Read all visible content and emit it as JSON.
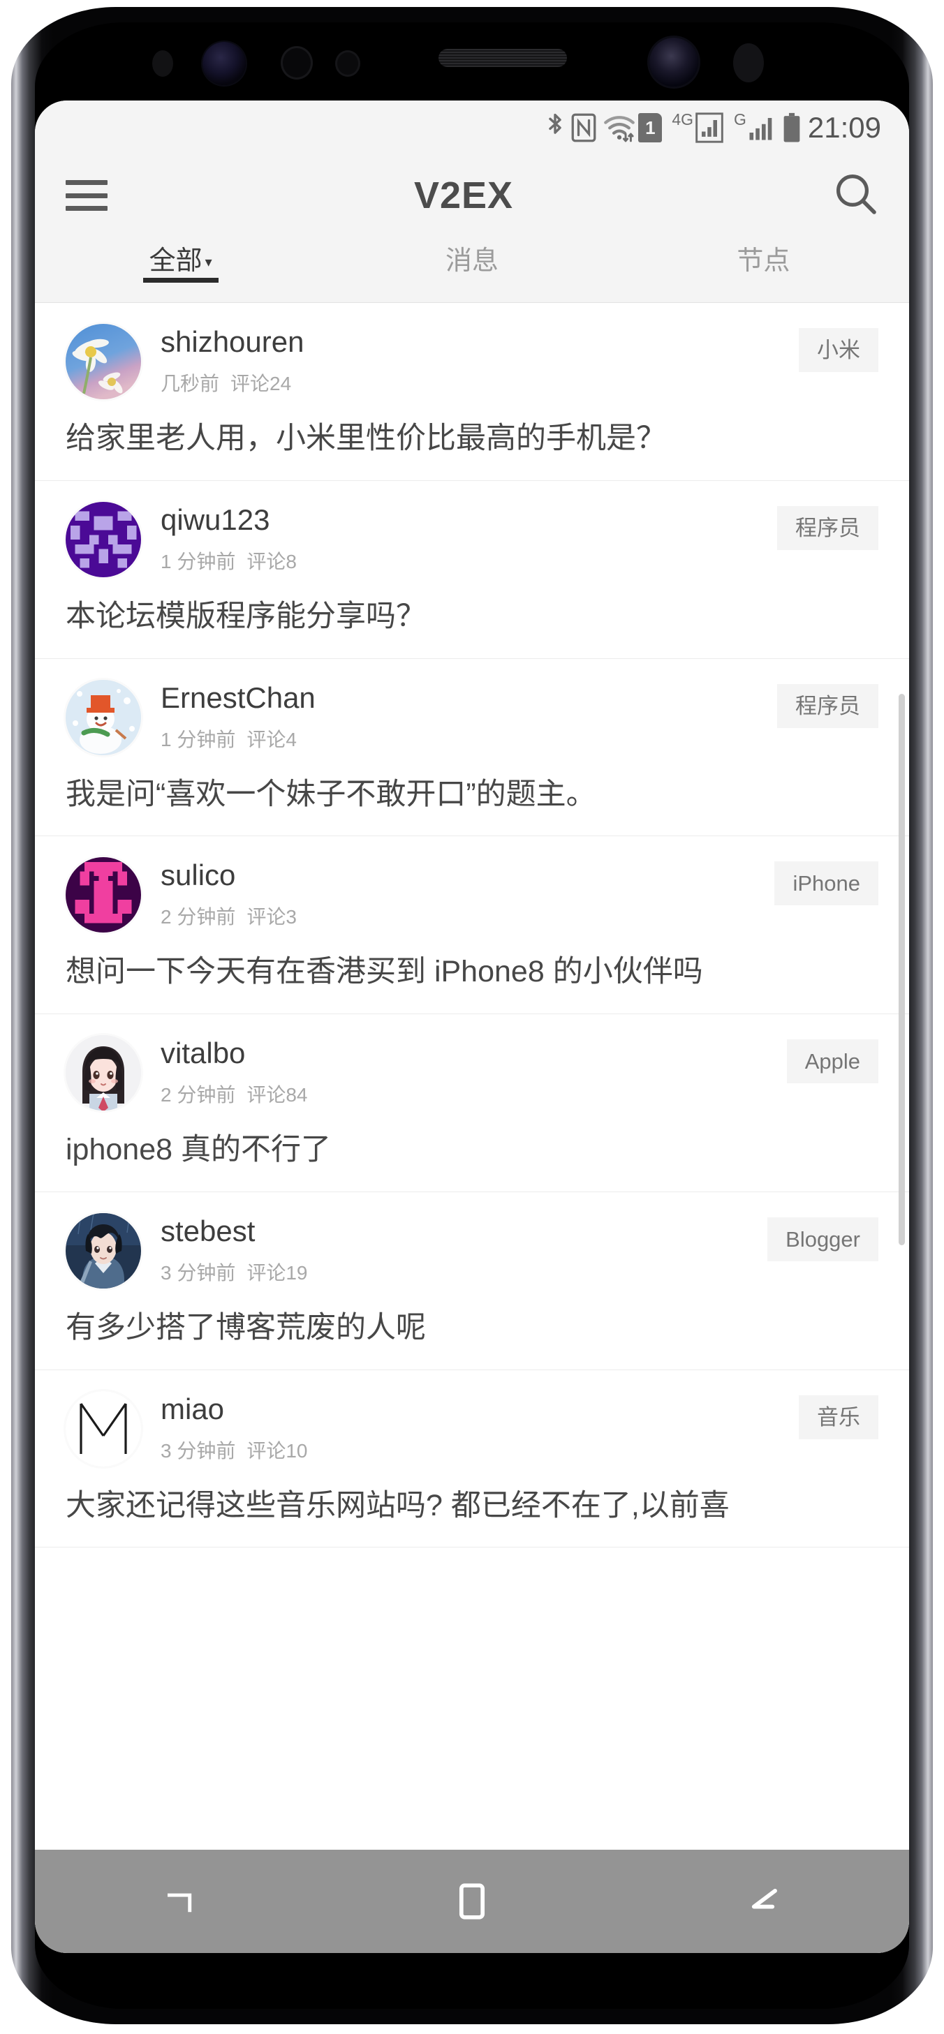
{
  "status_bar": {
    "icons": [
      "bluetooth-icon",
      "nfc-icon",
      "wifi-icon",
      "sim-card-icon",
      "signal-4g-icon",
      "signal-g-icon",
      "battery-icon"
    ],
    "sim_label": "1",
    "net_4g_label": "4G",
    "net_g_label": "G",
    "time": "21:09"
  },
  "app_bar": {
    "menu_icon": "hamburger-menu-icon",
    "title": "V2EX",
    "search_icon": "search-icon"
  },
  "tabs": [
    {
      "label": "全部",
      "caret": "▾",
      "active": true
    },
    {
      "label": "消息",
      "caret": "",
      "active": false
    },
    {
      "label": "节点",
      "caret": "",
      "active": false
    }
  ],
  "feed": {
    "posts": [
      {
        "username": "shizhouren",
        "time": "几秒前",
        "comments": "评论24",
        "tag": "小米",
        "title": "给家里老人用，小米里性价比最高的手机是？",
        "avatar": "flower-photo-avatar"
      },
      {
        "username": "qiwu123",
        "time": "1 分钟前",
        "comments": "评论8",
        "tag": "程序员",
        "title": "本论坛模版程序能分享吗？",
        "avatar": "purple-identicon-avatar"
      },
      {
        "username": "ErnestChan",
        "time": "1 分钟前",
        "comments": "评论4",
        "tag": "程序员",
        "title": "我是问“喜欢一个妹子不敢开口”的题主。",
        "avatar": "snowman-illustration-avatar"
      },
      {
        "username": "sulico",
        "time": "2 分钟前",
        "comments": "评论3",
        "tag": "iPhone",
        "title": "想问一下今天有在香港买到 iPhone8 的小伙伴吗",
        "avatar": "pink-identicon-avatar"
      },
      {
        "username": "vitalbo",
        "time": "2 分钟前",
        "comments": "评论84",
        "tag": "Apple",
        "title": "iphone8 真的不行了",
        "avatar": "anime-girl-avatar"
      },
      {
        "username": "stebest",
        "time": "3 分钟前",
        "comments": "评论19",
        "tag": "Blogger",
        "title": "有多少搭了博客荒废的人呢",
        "avatar": "anime-boy-avatar"
      },
      {
        "username": "miao",
        "time": "3 分钟前",
        "comments": "评论10",
        "tag": "音乐",
        "title": "大家还记得这些音乐网站吗? 都已经不在了,以前喜",
        "avatar": "letter-m-avatar"
      }
    ]
  },
  "nav_bar": {
    "recents_icon": "recents-square-icon",
    "home_icon": "home-square-icon",
    "back_icon": "back-arrow-icon"
  },
  "colors": {
    "app_bar_bg": "#f4f4f4",
    "tag_bg": "#f4f4f4",
    "active_tab": "#2b2b2b",
    "title_text": "#474747",
    "muted_text": "#a8a8a8"
  }
}
